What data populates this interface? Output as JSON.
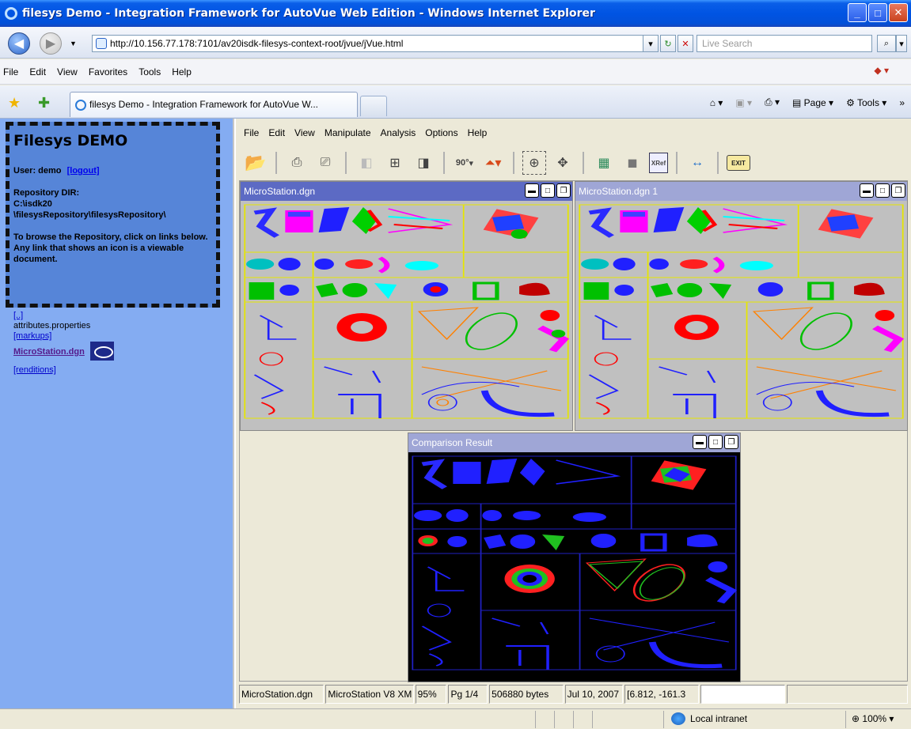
{
  "window": {
    "title": "filesys Demo - Integration Framework for AutoVue Web Edition - Windows Internet Explorer"
  },
  "address": {
    "url": "http://10.156.77.178:7101/av20isdk-filesys-context-root/jvue/jVue.html",
    "search_placeholder": "Live Search"
  },
  "ie_menu": [
    "File",
    "Edit",
    "View",
    "Favorites",
    "Tools",
    "Help"
  ],
  "tab": {
    "label": "filesys Demo - Integration Framework for AutoVue W..."
  },
  "command_bar": {
    "page": "Page",
    "tools": "Tools"
  },
  "sidebar": {
    "heading": "Filesys DEMO",
    "user_label": "User: demo",
    "logout": "[logout]",
    "repo_label": "Repository DIR:",
    "repo_path_1": "C:\\isdk20",
    "repo_path_2": "\\filesysRepository\\filesysRepository\\",
    "browse_help": "To browse the Repository, click on links below. Any link that shows an icon is a viewable document.",
    "links": {
      "parent": "[..]",
      "attributes": "attributes.properties",
      "markups": "[markups]",
      "microstation": "MicroStation.dgn",
      "renditions": "[renditions]"
    }
  },
  "viewer": {
    "menu": [
      "File",
      "Edit",
      "View",
      "Manipulate",
      "Analysis",
      "Options",
      "Help"
    ],
    "windows": {
      "left": "MicroStation.dgn",
      "right": "MicroStation.dgn 1",
      "compare": "Comparison Result"
    },
    "status": {
      "file": "MicroStation.dgn",
      "format": "MicroStation V8 XM",
      "zoom": "95%",
      "page": "Pg 1/4",
      "size": "506880 bytes",
      "date": "Jul 10, 2007",
      "coords": "[6.812, -161.3"
    },
    "toolbar_labels": {
      "rotate": "90°",
      "xref": "XRef",
      "exit": "EXIT"
    }
  },
  "ie_status": {
    "zone": "Local intranet",
    "zoom": "100%"
  }
}
